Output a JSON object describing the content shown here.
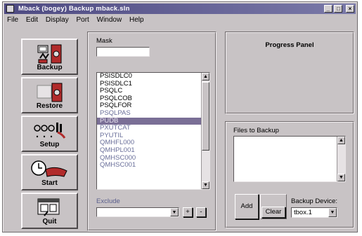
{
  "window": {
    "title": "Mback (bogey) Backup mback.sln"
  },
  "titlebar_buttons": [
    "_",
    "□",
    "×"
  ],
  "menu": [
    "File",
    "Edit",
    "Display",
    "Port",
    "Window",
    "Help"
  ],
  "toolbar": {
    "backup": "Backup",
    "restore": "Restore",
    "setup": "Setup",
    "start": "Start",
    "quit": "Quit"
  },
  "mask": {
    "label": "Mask",
    "value": ""
  },
  "source_list": {
    "items": [
      "PSISDLC0",
      "PSISDLC1",
      "PSQLC",
      "PSQLCOB",
      "PSQLFOR",
      "PSQLPAS",
      "PUDB",
      "PXUTCAT",
      "PYUTIL",
      "QMHFL000",
      "QMHPL001",
      "QMHSC000",
      "QMHSC001"
    ],
    "selected_index": 6,
    "dim_indices": [
      5,
      7,
      8,
      9,
      10,
      11,
      12
    ]
  },
  "exclude": {
    "label": "Exclude",
    "value": "",
    "add_label": "+",
    "remove_label": "-"
  },
  "progress_panel": {
    "title": "Progress Panel"
  },
  "files_to_backup": {
    "label": "Files to Backup",
    "items": []
  },
  "actions": {
    "add": "Add",
    "clear": "Clear"
  },
  "backup_device": {
    "label": "Backup Device:",
    "value": "tbox.1"
  }
}
